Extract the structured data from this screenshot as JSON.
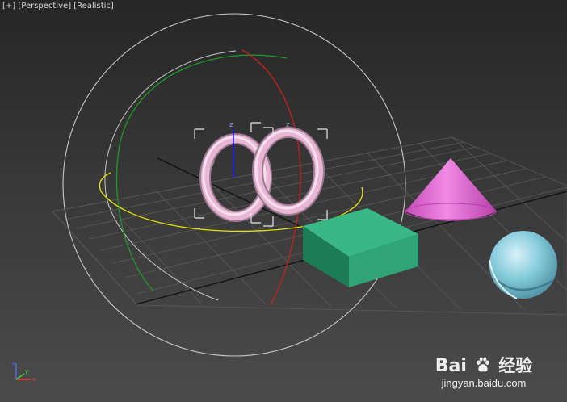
{
  "viewport": {
    "label_parts": [
      "[+]",
      "[Perspective]",
      "[Realistic]"
    ],
    "background_top": "#262626",
    "background_bottom": "#4b4b4b"
  },
  "gizmo": {
    "axis_colors": {
      "x": "#c82020",
      "y": "#1f9a2a",
      "z": "#1a1aff",
      "plane": "#e6e600"
    },
    "axis_labels": {
      "z": "z",
      "y": "y",
      "x": "x"
    }
  },
  "objects": [
    {
      "name": "torus",
      "color": "#e8b5d4"
    },
    {
      "name": "box",
      "color": "#2fa476"
    },
    {
      "name": "cone",
      "color": "#e261d6"
    },
    {
      "name": "sphere",
      "color": "#86ccdc"
    }
  ],
  "watermark": {
    "brand_left": "Bai",
    "brand_right": "经验",
    "url": "jingyan.baidu.com"
  }
}
